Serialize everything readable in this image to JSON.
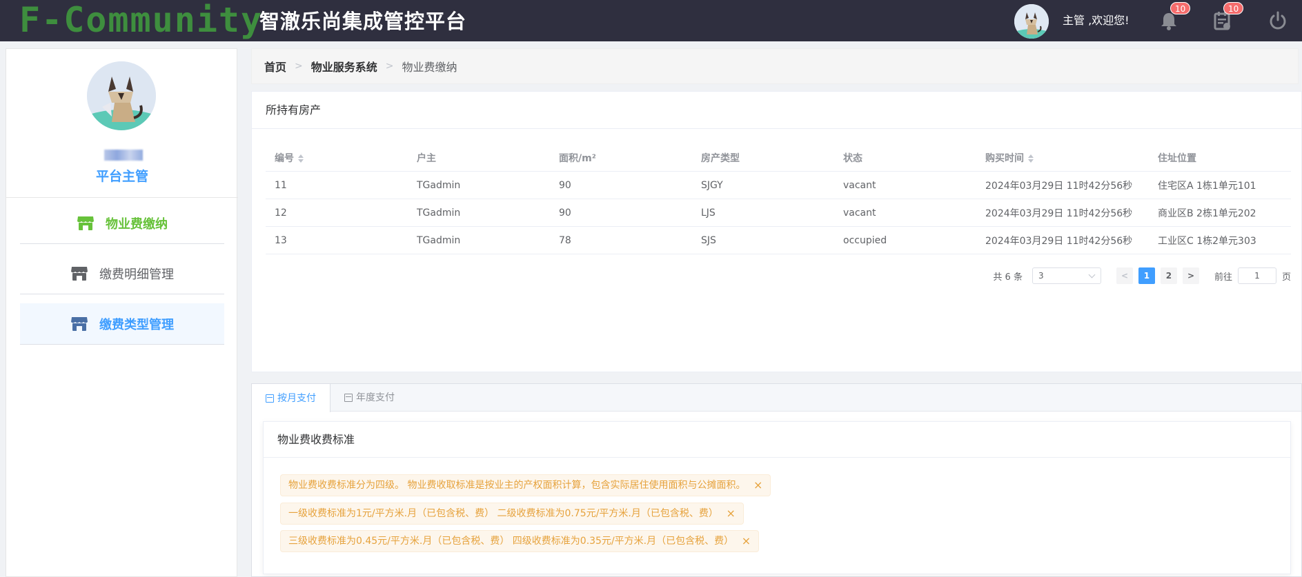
{
  "header": {
    "logo_text": "F-Community",
    "app_title": "智澈乐尚集成管控平台",
    "welcome": "主管 ,欢迎您!",
    "notification_count": "10",
    "task_count": "10"
  },
  "sidebar": {
    "role": "平台主管",
    "items": [
      {
        "label": "物业费缴纳"
      },
      {
        "label": "缴费明细管理"
      },
      {
        "label": "缴费类型管理"
      }
    ]
  },
  "breadcrumb": {
    "home": "首页",
    "system": "物业服务系统",
    "current": "物业费缴纳"
  },
  "property": {
    "title": "所持有房产",
    "columns": [
      "编号",
      "户主",
      "面积/m²",
      "房产类型",
      "状态",
      "购买时间",
      "住址位置"
    ],
    "rows": [
      [
        "11",
        "TGadmin",
        "90",
        "SJGY",
        "vacant",
        "2024年03月29日 11时42分56秒",
        "住宅区A 1栋1单元101"
      ],
      [
        "12",
        "TGadmin",
        "90",
        "LJS",
        "vacant",
        "2024年03月29日 11时42分56秒",
        "商业区B 2栋1单元202"
      ],
      [
        "13",
        "TGadmin",
        "78",
        "SJS",
        "occupied",
        "2024年03月29日 11时42分56秒",
        "工业区C 1栋2单元303"
      ]
    ],
    "pagination": {
      "total": "共 6 条",
      "page_size": "3",
      "pages": [
        "1",
        "2"
      ],
      "current_page": "1",
      "goto_label": "前往",
      "goto_value": "1",
      "page_unit": "页"
    }
  },
  "payment": {
    "tabs": [
      {
        "label": "按月支付"
      },
      {
        "label": "年度支付"
      }
    ],
    "card_title": "物业费收费标准",
    "notices": [
      "物业费收费标准分为四级。 物业费收取标准是按业主的产权面积计算，包含实际居住使用面积与公摊面积。",
      "一级收费标准为1元/平方米.月（已包含税、费） 二级收费标准为0.75元/平方米.月（已包含税、费）",
      "三级收费标准为0.45元/平方米.月（已包含税、费） 四级收费标准为0.35元/平方米.月（已包含税、费）"
    ]
  },
  "colors": {
    "topbar": "#2f2f3f",
    "logo": "#3e8e3e",
    "primary": "#409eff",
    "active_menu": "#67c23a",
    "warning": "#e6a23c"
  },
  "icons": [
    "cat-avatar-icon",
    "bell-icon",
    "task-list-icon",
    "power-icon",
    "shop-icon",
    "calendar-icon",
    "close-icon",
    "sort-icon"
  ]
}
